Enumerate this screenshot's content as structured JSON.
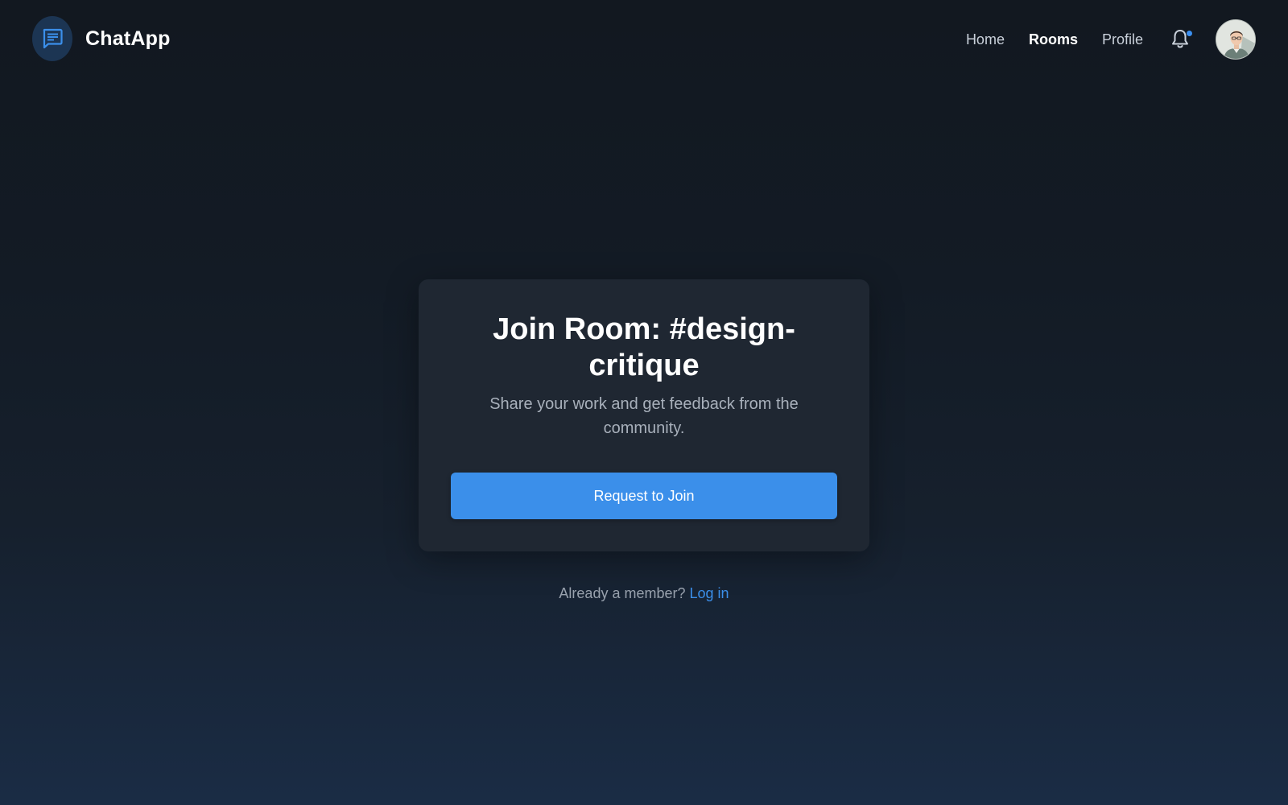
{
  "app": {
    "name": "ChatApp",
    "accent_color": "#3b8fea",
    "logo_icon": "chat-bubble-icon"
  },
  "nav": {
    "items": [
      {
        "label": "Home",
        "active": false
      },
      {
        "label": "Rooms",
        "active": true
      },
      {
        "label": "Profile",
        "active": false
      }
    ],
    "notification_icon": "bell-icon",
    "has_unread_notifications": true
  },
  "card": {
    "title": "Join Room: #design-critique",
    "subtitle": "Share your work and get feedback from the community.",
    "button_label": "Request to Join"
  },
  "footer": {
    "prompt": "Already a member?",
    "link_label": "Log in"
  }
}
